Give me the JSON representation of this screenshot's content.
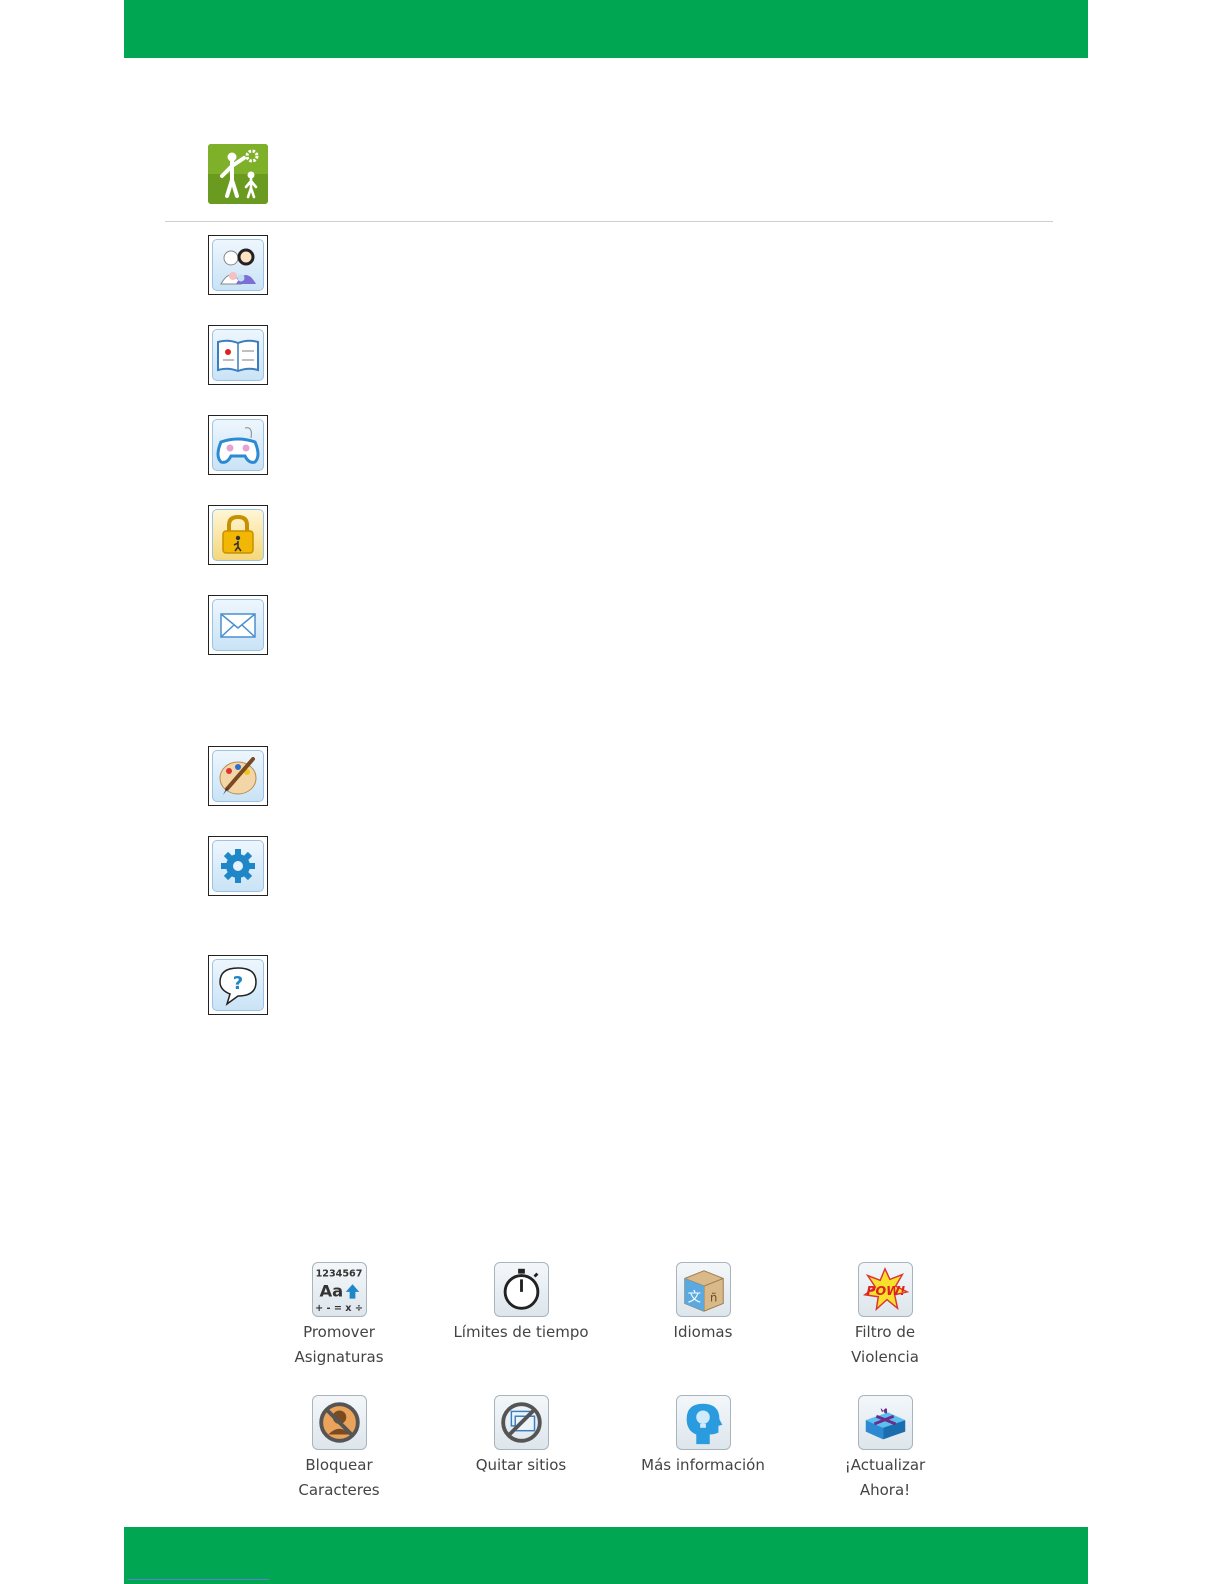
{
  "colors": {
    "band_green": "#00a651",
    "divider": "#cfcfcf",
    "link_blue": "#5b7fd6"
  },
  "header": {
    "icon": "parent-control-icon"
  },
  "menu_icons": [
    {
      "icon": "family-icon"
    },
    {
      "icon": "book-icon"
    },
    {
      "icon": "gamepad-icon"
    },
    {
      "icon": "lock-icon"
    },
    {
      "icon": "envelope-icon"
    },
    {
      "icon": "palette-icon"
    },
    {
      "icon": "gear-icon"
    },
    {
      "icon": "help-bubble-icon"
    }
  ],
  "tiles": [
    {
      "label": "Promover\nAsignaturas",
      "icon": "subjects-icon"
    },
    {
      "label": "Límites de tiempo",
      "icon": "stopwatch-icon"
    },
    {
      "label": "Idiomas",
      "icon": "language-cube-icon"
    },
    {
      "label": "Filtro de\nViolencia",
      "icon": "pow-icon"
    },
    {
      "label": "Bloquear\nCaracteres",
      "icon": "block-character-icon"
    },
    {
      "label": "Quitar sitios",
      "icon": "remove-sites-icon"
    },
    {
      "label": "Más información",
      "icon": "info-head-icon"
    },
    {
      "label": "¡Actualizar\nAhora!",
      "icon": "gift-icon"
    }
  ]
}
